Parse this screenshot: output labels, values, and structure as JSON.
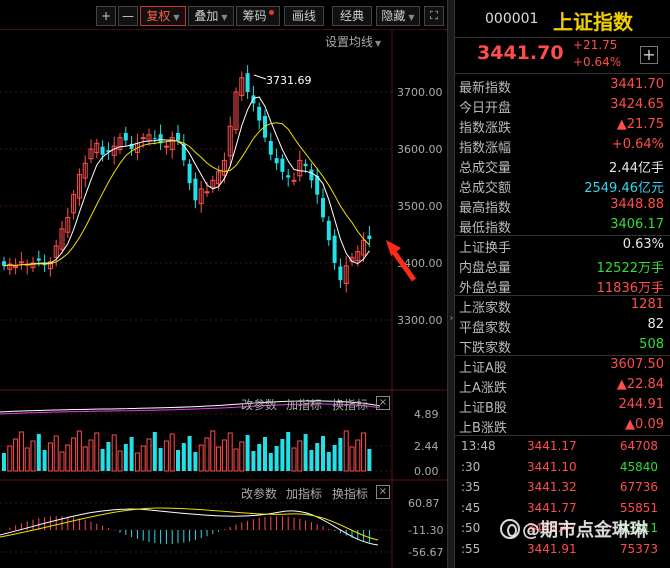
{
  "toolbar": {
    "plus": "+",
    "minus": "—",
    "restore_rights": "复权",
    "overlay": "叠加",
    "chips": "筹码",
    "draw_line": "画线",
    "classic": "经典",
    "hide": "隐藏",
    "expand": "⛶"
  },
  "ma_settings": "设置均线",
  "main_chart": {
    "y_ticks": [
      "3700.00",
      "3600.00",
      "3500.00",
      "3400.00",
      "3300.00"
    ],
    "high_label": "3731.69"
  },
  "volume_panel": {
    "modify_params": "改参数",
    "add_indicator": "加指标",
    "switch_indicator": "换指标",
    "close": "×",
    "y_ticks": [
      "4.89",
      "2.44",
      "0.00"
    ]
  },
  "macd_panel": {
    "modify_params": "改参数",
    "add_indicator": "加指标",
    "switch_indicator": "换指标",
    "close": "×",
    "y_ticks": [
      "60.87",
      "-11.30",
      "-56.67"
    ]
  },
  "quote": {
    "code": "000001",
    "name": "上证指数",
    "price": "3441.70",
    "change": "+21.75",
    "change_pct": "+0.64%",
    "add": "+",
    "rows": [
      {
        "label": "最新指数",
        "value": "3441.70",
        "color": "red"
      },
      {
        "label": "今日开盘",
        "value": "3424.65",
        "color": "red"
      },
      {
        "label": "指数涨跌",
        "value": "▲21.75",
        "color": "red"
      },
      {
        "label": "指数涨幅",
        "value": "+0.64%",
        "color": "red"
      },
      {
        "label": "总成交量",
        "value": "2.44亿手",
        "color": "white"
      },
      {
        "label": "总成交额",
        "value": "2549.46亿元",
        "color": "cyan"
      },
      {
        "label": "最高指数",
        "value": "3448.88",
        "color": "red"
      },
      {
        "label": "最低指数",
        "value": "3406.17",
        "color": "green"
      },
      {
        "label": "上证换手",
        "value": "0.63%",
        "color": "white"
      },
      {
        "label": "内盘总量",
        "value": "12522万手",
        "color": "green"
      },
      {
        "label": "外盘总量",
        "value": "11836万手",
        "color": "red"
      },
      {
        "label": "上涨家数",
        "value": "1281",
        "color": "red"
      },
      {
        "label": "平盘家数",
        "value": "82",
        "color": "white"
      },
      {
        "label": "下跌家数",
        "value": "508",
        "color": "green"
      },
      {
        "label": "上证A股",
        "value": "3607.50",
        "color": "red"
      },
      {
        "label": "上A涨跌",
        "value": "▲22.84",
        "color": "red"
      },
      {
        "label": "上证B股",
        "value": "244.91",
        "color": "red"
      },
      {
        "label": "上B涨跌",
        "value": "▲0.09",
        "color": "red"
      }
    ],
    "ticks": [
      {
        "time": "13:48",
        "price": "3441.17",
        "vol": "64708",
        "color": "red"
      },
      {
        "time": ":30",
        "price": "3441.10",
        "vol": "45840",
        "color": "green"
      },
      {
        "time": ":35",
        "price": "3441.32",
        "vol": "67736",
        "color": "red"
      },
      {
        "time": ":45",
        "price": "3441.77",
        "vol": "55851",
        "color": "red"
      },
      {
        "time": ":50",
        "price": "3441.47",
        "vol": "93211",
        "color": "green"
      },
      {
        "time": ":55",
        "price": "3441.91",
        "vol": "75373",
        "color": "red"
      }
    ]
  },
  "watermark": "@期市点金琳琳",
  "colors": {
    "up": "#ff4d4d",
    "down": "#22e0e8",
    "ma5": "#ffffff",
    "ma10": "#f0e000",
    "ma_pink": "#e040e0",
    "grid": "#4a1010",
    "arrow": "#ff2a1a"
  }
}
